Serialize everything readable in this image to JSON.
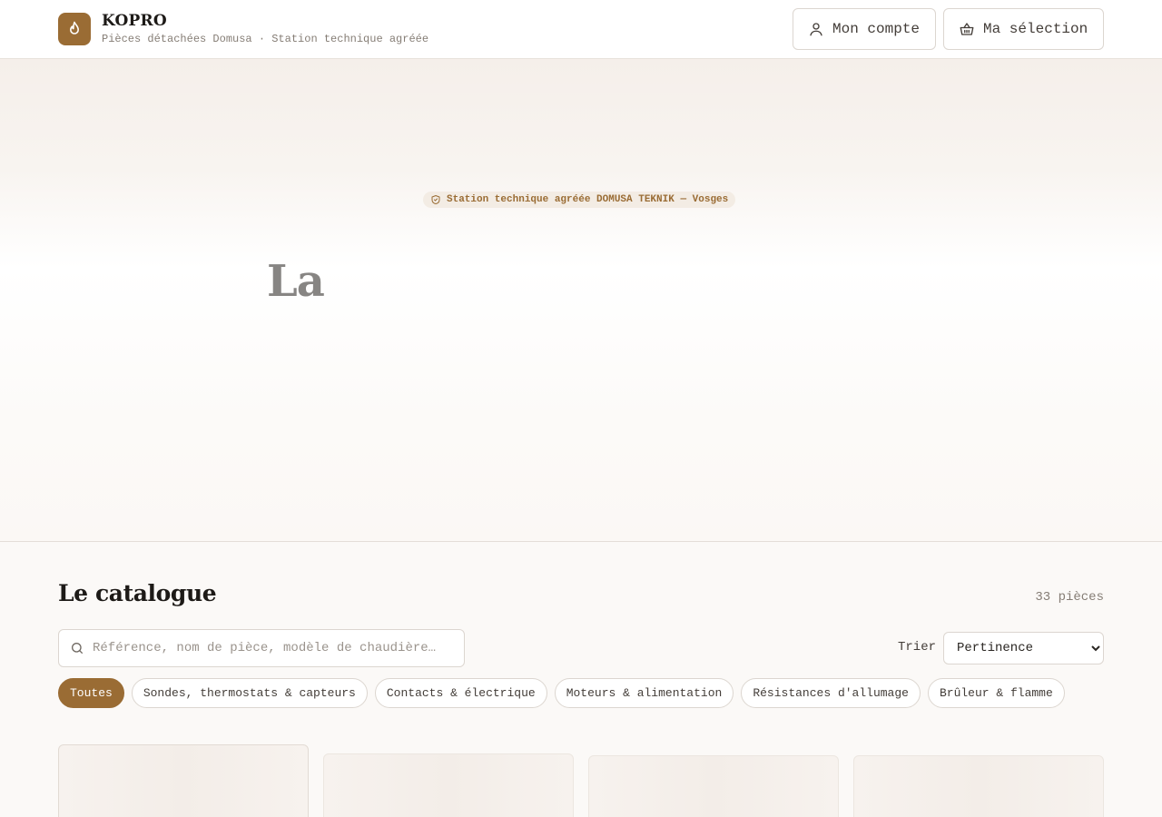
{
  "header": {
    "brand_name": "KOPRO",
    "brand_tagline": "Pièces détachées Domusa · Station technique agréée",
    "account_label": "Mon compte",
    "selection_label": "Ma sélection",
    "logo_icon": "flame-icon",
    "account_icon": "user-icon",
    "selection_icon": "basket-icon"
  },
  "hero": {
    "badge_text": "Station technique agréée DOMUSA TEKNIK — Vosges",
    "badge_icon": "shield-check-icon",
    "title": "La"
  },
  "catalogue": {
    "title": "Le catalogue",
    "count": "33 pièces",
    "search_placeholder": "Référence, nom de pièce, modèle de chaudière…",
    "search_value": "",
    "sort_label": "Trier",
    "sort_selected": "Pertinence",
    "categories": [
      {
        "label": "Toutes",
        "active": true
      },
      {
        "label": "Sondes, thermostats & capteurs",
        "active": false
      },
      {
        "label": "Contacts & électrique",
        "active": false
      },
      {
        "label": "Moteurs & alimentation",
        "active": false
      },
      {
        "label": "Résistances d'allumage",
        "active": false
      },
      {
        "label": "Brûleur & flamme",
        "active": false
      }
    ]
  },
  "colors": {
    "accent": "#9a6c34",
    "text": "#1d1a17",
    "muted": "#857d75",
    "border": "#dcd6d0"
  }
}
